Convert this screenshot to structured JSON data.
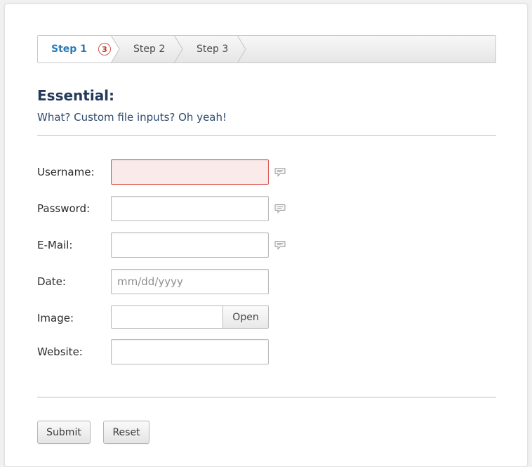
{
  "steps": [
    {
      "label": "Step 1",
      "badge": "3",
      "active": true
    },
    {
      "label": "Step 2",
      "active": false
    },
    {
      "label": "Step 3",
      "active": false
    }
  ],
  "section": {
    "title": "Essential:",
    "subtitle": "What? Custom file inputs? Oh yeah!"
  },
  "form": {
    "username": {
      "label": "Username:",
      "value": "",
      "state": "error"
    },
    "password": {
      "label": "Password:",
      "value": ""
    },
    "email": {
      "label": "E-Mail:",
      "value": ""
    },
    "date": {
      "label": "Date:",
      "placeholder": "mm/dd/yyyy",
      "value": ""
    },
    "image": {
      "label": "Image:",
      "value": "",
      "button_label": "Open"
    },
    "website": {
      "label": "Website:",
      "value": ""
    }
  },
  "actions": {
    "submit_label": "Submit",
    "reset_label": "Reset"
  },
  "colors": {
    "accent": "#2a7ab8",
    "heading": "#243a5a",
    "error_bg": "#fbeaea",
    "error_border": "#d9534f"
  },
  "icons": {
    "field_hint": "speech-bubble-icon"
  }
}
